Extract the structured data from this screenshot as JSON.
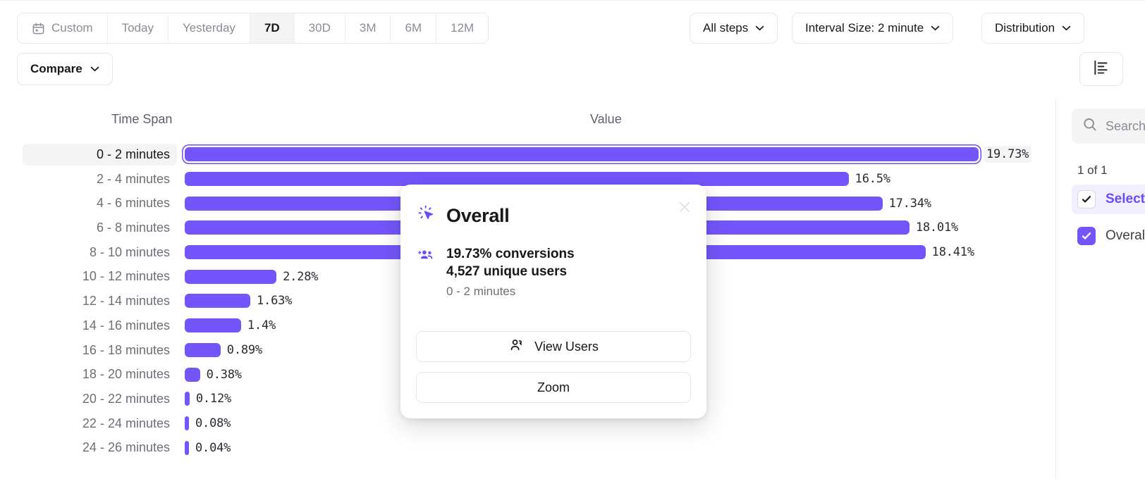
{
  "theme": {
    "accent": "#7455fb",
    "accent_dark": "#6b4df6",
    "bar_color": "#7455fb",
    "selected_row_bg": "#f4f4f5",
    "sidebar_highlight": "#f1eeff"
  },
  "toolbar": {
    "range_segments": [
      {
        "label": "Custom",
        "icon": "calendar-icon",
        "active": false
      },
      {
        "label": "Today",
        "active": false
      },
      {
        "label": "Yesterday",
        "active": false
      },
      {
        "label": "7D",
        "active": true
      },
      {
        "label": "30D",
        "active": false
      },
      {
        "label": "3M",
        "active": false
      },
      {
        "label": "6M",
        "active": false
      },
      {
        "label": "12M",
        "active": false
      }
    ],
    "steps_label": "All steps",
    "interval_label": "Interval Size: 2 minute",
    "distribution_label": "Distribution",
    "compare_label": "Compare",
    "table_view_icon": "table-view-icon"
  },
  "chart_data": {
    "type": "bar",
    "orientation": "horizontal",
    "title": "",
    "xlabel": "Value",
    "ylabel": "Time Span",
    "columns": [
      "Time Span",
      "Value"
    ],
    "value_unit": "%",
    "xlim": [
      0,
      19.73
    ],
    "grid": false,
    "legend_position": "right-panel",
    "selected_category": "0 - 2 minutes",
    "categories": [
      "0 - 2 minutes",
      "2 - 4 minutes",
      "4 - 6 minutes",
      "6 - 8 minutes",
      "8 - 10 minutes",
      "10 - 12 minutes",
      "12 - 14 minutes",
      "14 - 16 minutes",
      "16 - 18 minutes",
      "18 - 20 minutes",
      "20 - 22 minutes",
      "22 - 24 minutes",
      "24 - 26 minutes"
    ],
    "values": [
      19.73,
      16.5,
      17.34,
      18.01,
      18.41,
      2.28,
      1.63,
      1.4,
      0.89,
      0.38,
      0.12,
      0.08,
      0.04
    ],
    "value_labels": [
      "19.73%",
      "16.5%",
      "17.34%",
      "18.01%",
      "18.41%",
      "2.28%",
      "1.63%",
      "1.4%",
      "0.89%",
      "0.38%",
      "0.12%",
      "0.08%",
      "0.04%"
    ],
    "series": [
      {
        "name": "Overall",
        "values": [
          19.73,
          16.5,
          17.34,
          18.01,
          18.41,
          2.28,
          1.63,
          1.4,
          0.89,
          0.38,
          0.12,
          0.08,
          0.04
        ]
      }
    ]
  },
  "popover": {
    "title": "Overall",
    "title_icon": "cursor-click-icon",
    "close_icon": "close-icon",
    "stats_icon": "users-group-icon",
    "conversions": "19.73% conversions",
    "unique_users": "4,527 unique users",
    "bucket": "0 - 2 minutes",
    "view_users_label": "View Users",
    "view_users_icon": "user-icon",
    "zoom_label": "Zoom"
  },
  "sidebar": {
    "search_placeholder": "Search",
    "search_icon": "search-icon",
    "count_text": "1 of 1",
    "items": [
      {
        "label": "Select all",
        "checked": true,
        "style": "outline",
        "highlighted": true
      },
      {
        "label": "Overall",
        "checked": true,
        "style": "filled",
        "highlighted": false
      }
    ]
  }
}
